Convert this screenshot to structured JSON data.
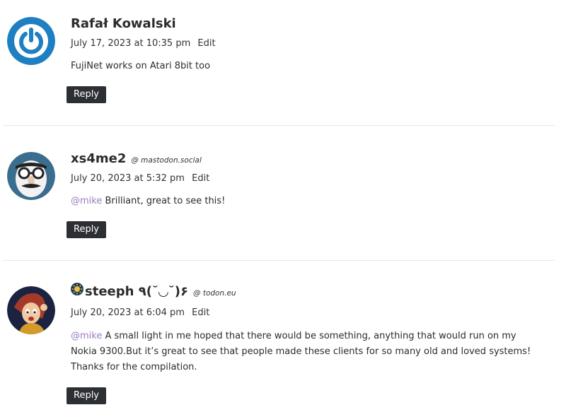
{
  "comments": [
    {
      "author": "Rafał Kowalski",
      "instance": "",
      "date": "July 17, 2023 at 10:35 pm",
      "edit_label": "Edit",
      "mention": "",
      "text": "FujiNet works on Atari 8bit too",
      "reply_label": "Reply",
      "avatar_icon": "power-icon"
    },
    {
      "author": "xs4me2",
      "instance": "@ mastodon.social",
      "date": "July 20, 2023 at 5:32 pm",
      "edit_label": "Edit",
      "mention": "@mike",
      "text": " Brilliant, great to see this!",
      "reply_label": "Reply",
      "avatar_icon": "groucho-glasses-icon"
    },
    {
      "author": "steeph ٩(˘◡˘)۶",
      "instance": "@ todon.eu",
      "date": "July 20, 2023 at 6:04 pm",
      "edit_label": "Edit",
      "mention": "@mike",
      "text": " A small light in me hoped that there would be something, anything that would run on my Nokia 9300.But it’s great to see that people made these clients for so many old and loved systems! Thanks for the compilation.",
      "reply_label": "Reply",
      "avatar_icon": "cartoon-portrait-icon"
    }
  ],
  "colors": {
    "mention": "#9b7bc2",
    "button_bg": "#2c2f33",
    "divider": "#e6e6e6",
    "power_blue": "#1e7fc2"
  }
}
